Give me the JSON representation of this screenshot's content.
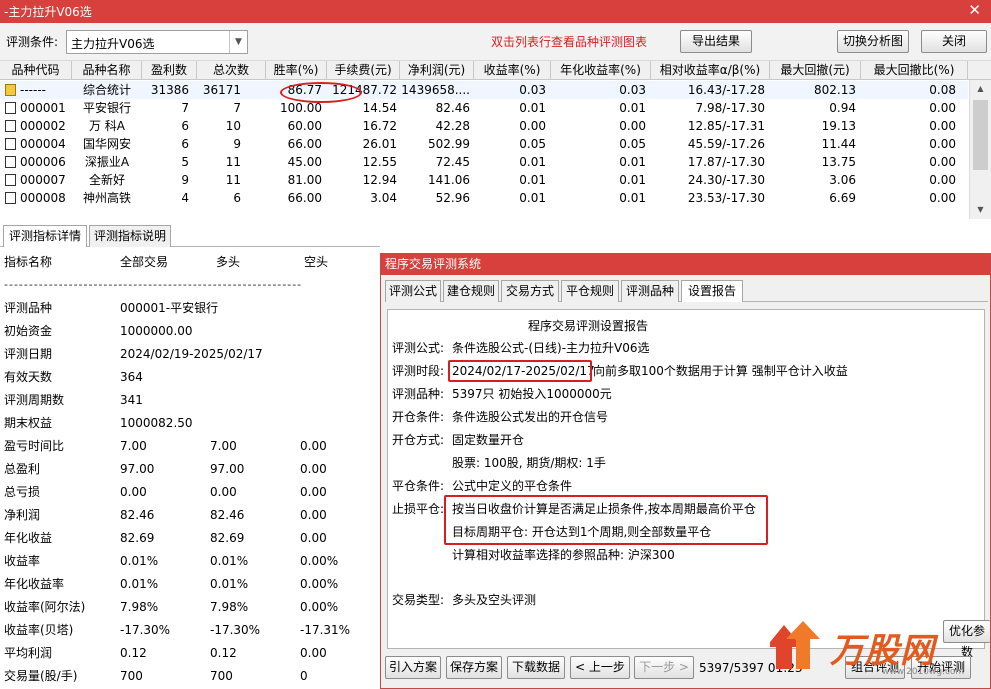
{
  "window": {
    "title": "-主力拉升V06选",
    "close_glyph": "✕"
  },
  "toolbar": {
    "condition_label": "评测条件:",
    "condition_value": "主力拉升V06选",
    "hint": "双击列表行查看品种评测图表",
    "export_label": "导出结果",
    "switch_label": "切换分析图",
    "close_label": "关闭"
  },
  "table": {
    "columns": [
      "品种代码",
      "品种名称",
      "盈利数",
      "总次数",
      "胜率(%)",
      "手续费(元)",
      "净利润(元)",
      "收益率(%)",
      "年化收益率(%)",
      "相对收益率α/β(%)",
      "最大回撤(元)",
      "最大回撤比(%)"
    ],
    "rows": [
      [
        "------",
        "综合统计",
        "31386",
        "36171",
        "86.77",
        "121487.72",
        "1439658....",
        "0.03",
        "0.03",
        "16.43/-17.28",
        "802.13",
        "0.08"
      ],
      [
        "000001",
        "平安银行",
        "7",
        "7",
        "100.00",
        "14.54",
        "82.46",
        "0.01",
        "0.01",
        "7.98/-17.30",
        "0.94",
        "0.00"
      ],
      [
        "000002",
        "万 科A",
        "6",
        "10",
        "60.00",
        "16.72",
        "42.28",
        "0.00",
        "0.00",
        "12.85/-17.31",
        "19.13",
        "0.00"
      ],
      [
        "000004",
        "国华网安",
        "6",
        "9",
        "66.00",
        "26.01",
        "502.99",
        "0.05",
        "0.05",
        "45.59/-17.26",
        "11.44",
        "0.00"
      ],
      [
        "000006",
        "深振业A",
        "5",
        "11",
        "45.00",
        "12.55",
        "72.45",
        "0.01",
        "0.01",
        "17.87/-17.30",
        "13.75",
        "0.00"
      ],
      [
        "000007",
        "全新好",
        "9",
        "11",
        "81.00",
        "12.94",
        "141.06",
        "0.01",
        "0.01",
        "24.30/-17.30",
        "3.06",
        "0.00"
      ],
      [
        "000008",
        "神州高铁",
        "4",
        "6",
        "66.00",
        "3.04",
        "52.96",
        "0.01",
        "0.01",
        "23.53/-17.30",
        "6.69",
        "0.00"
      ]
    ]
  },
  "left_tabs": [
    "评测指标详情",
    "评测指标说明"
  ],
  "detail": {
    "headers": [
      "指标名称",
      "全部交易",
      "多头",
      "空头"
    ],
    "dashes": "------------------------------------------------------------",
    "info": [
      {
        "label": "评测品种",
        "value": "000001-平安银行"
      },
      {
        "label": "初始资金",
        "value": "1000000.00"
      },
      {
        "label": "评测日期",
        "value": "2024/02/19-2025/02/17"
      },
      {
        "label": "有效天数",
        "value": "364"
      },
      {
        "label": "评测周期数",
        "value": "341"
      },
      {
        "label": "期末权益",
        "value": "1000082.50"
      }
    ],
    "metrics": [
      {
        "label": "盈亏时间比",
        "all": "7.00",
        "long": "7.00",
        "short": "0.00"
      },
      {
        "label": "总盈利",
        "all": "97.00",
        "long": "97.00",
        "short": "0.00"
      },
      {
        "label": "总亏损",
        "all": "0.00",
        "long": "0.00",
        "short": "0.00"
      },
      {
        "label": "净利润",
        "all": "82.46",
        "long": "82.46",
        "short": "0.00"
      },
      {
        "label": "年化收益",
        "all": "82.69",
        "long": "82.69",
        "short": "0.00"
      },
      {
        "label": "收益率",
        "all": "0.01%",
        "long": "0.01%",
        "short": "0.00%"
      },
      {
        "label": "年化收益率",
        "all": "0.01%",
        "long": "0.01%",
        "short": "0.00%"
      },
      {
        "label": "收益率(阿尔法)",
        "all": "7.98%",
        "long": "7.98%",
        "short": "0.00%"
      },
      {
        "label": "收益率(贝塔)",
        "all": "-17.30%",
        "long": "-17.30%",
        "short": "-17.31%"
      },
      {
        "label": "平均利润",
        "all": "0.12",
        "long": "0.12",
        "short": "0.00"
      },
      {
        "label": "交易量(股/手)",
        "all": "700",
        "long": "700",
        "short": "0"
      }
    ]
  },
  "dialog": {
    "title": "程序交易评测系统",
    "tabs": [
      "评测公式",
      "建仓规则",
      "交易方式",
      "平仓规则",
      "评测品种",
      "设置报告"
    ],
    "report": {
      "heading": "程序交易评测设置报告",
      "formula_label": "评测公式:",
      "formula_value": "条件选股公式-(日线)-主力拉升V06选",
      "period_label": "评测时段:",
      "period_value": "2024/02/17-2025/02/17",
      "period_note": "向前多取100个数据用于计算 强制平仓计入收益",
      "variety_label": "评测品种:",
      "variety_value": "5397只 初始投入1000000元",
      "open_cond_label": "开仓条件:",
      "open_cond_value": "条件选股公式发出的开仓信号",
      "open_mode_label": "开仓方式:",
      "open_mode_value": "固定数量开仓",
      "open_mode_detail": "股票: 100股, 期货/期权: 1手",
      "close_cond_label": "平仓条件:",
      "close_cond_value": "公式中定义的平仓条件",
      "stop_label": "止损平仓:",
      "stop_value": "按当日收盘价计算是否满足止损条件,按本周期最高价平仓",
      "target_value": "目标周期平仓: 开仓达到1个周期,则全部数量平仓",
      "ref_value": "计算相对收益率选择的参照品种: 沪深300",
      "trade_type_label": "交易类型:",
      "trade_type_value": "多头及空头评测"
    },
    "buttons": {
      "import": "引入方案",
      "save": "保存方案",
      "download": "下载数据",
      "prev": "< 上一步",
      "next": "下一步 >",
      "status": "5397/5397 01:23",
      "combine": "组合评测",
      "start": "开始评测",
      "optimize": "优化参数"
    }
  },
  "watermark": {
    "text": "万股网",
    "url": "www.2010wg.com"
  }
}
